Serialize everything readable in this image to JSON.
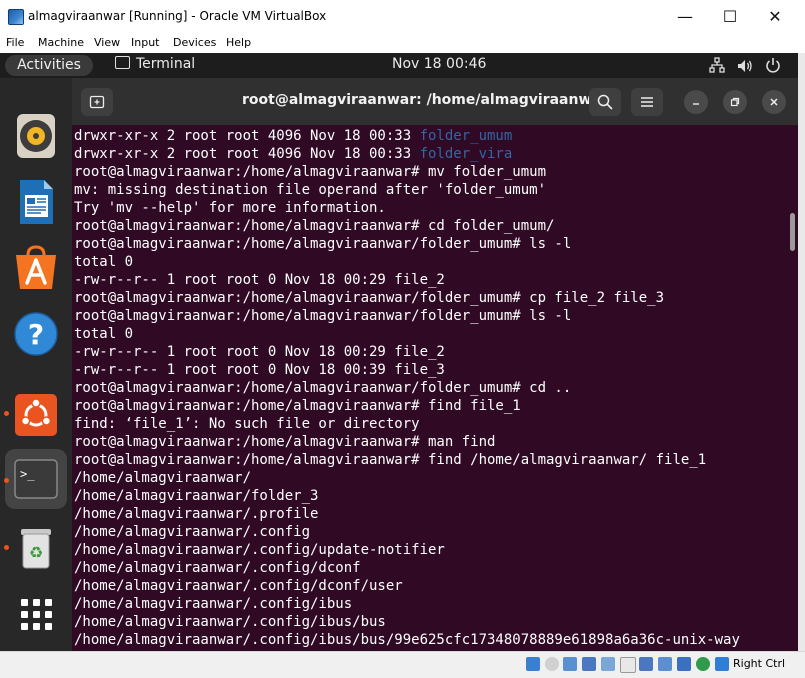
{
  "host": {
    "title": "almagviraanwar [Running] - Oracle VM VirtualBox",
    "controls": {
      "minimize": "—",
      "maximize": "☐",
      "close": "✕"
    },
    "menu": [
      "File",
      "Machine",
      "View",
      "Input",
      "Devices",
      "Help"
    ],
    "status_right": "Right Ctrl"
  },
  "gnome": {
    "activities": "Activities",
    "app": "Terminal",
    "clock": "Nov 18  00:46",
    "icons": [
      "network-icon",
      "volume-icon",
      "power-icon"
    ]
  },
  "dock": {
    "items": [
      "rhythmbox-icon",
      "writer-icon",
      "app-center-icon",
      "help-icon",
      "ubuntu-software-icon",
      "terminal-icon",
      "trash-icon",
      "show-apps-icon"
    ]
  },
  "terminal": {
    "title": "root@almagviraanwar: /home/almagviraanwar",
    "lines": [
      {
        "text": "drwxr-xr-x 2 root root 4096 Nov 18 00:33 ",
        "dir": "folder_umum"
      },
      {
        "text": "drwxr-xr-x 2 root root 4096 Nov 18 00:33 ",
        "dir": "folder_vira"
      },
      {
        "text": "root@almagviraanwar:/home/almagviraanwar# mv folder_umum"
      },
      {
        "text": "mv: missing destination file operand after 'folder_umum'"
      },
      {
        "text": "Try 'mv --help' for more information."
      },
      {
        "text": "root@almagviraanwar:/home/almagviraanwar# cd folder_umum/"
      },
      {
        "text": "root@almagviraanwar:/home/almagviraanwar/folder_umum# ls -l"
      },
      {
        "text": "total 0"
      },
      {
        "text": "-rw-r--r-- 1 root root 0 Nov 18 00:29 file_2"
      },
      {
        "text": "root@almagviraanwar:/home/almagviraanwar/folder_umum# cp file_2 file_3"
      },
      {
        "text": "root@almagviraanwar:/home/almagviraanwar/folder_umum# ls -l"
      },
      {
        "text": "total 0"
      },
      {
        "text": "-rw-r--r-- 1 root root 0 Nov 18 00:29 file_2"
      },
      {
        "text": "-rw-r--r-- 1 root root 0 Nov 18 00:39 file_3"
      },
      {
        "text": "root@almagviraanwar:/home/almagviraanwar/folder_umum# cd .."
      },
      {
        "text": "root@almagviraanwar:/home/almagviraanwar# find file_1"
      },
      {
        "text": "find: ‘file_1’: No such file or directory"
      },
      {
        "text": "root@almagviraanwar:/home/almagviraanwar# man find"
      },
      {
        "text": "root@almagviraanwar:/home/almagviraanwar# find /home/almagviraanwar/ file_1"
      },
      {
        "text": "/home/almagviraanwar/"
      },
      {
        "text": "/home/almagviraanwar/folder_3"
      },
      {
        "text": "/home/almagviraanwar/.profile"
      },
      {
        "text": "/home/almagviraanwar/.config"
      },
      {
        "text": "/home/almagviraanwar/.config/update-notifier"
      },
      {
        "text": "/home/almagviraanwar/.config/dconf"
      },
      {
        "text": "/home/almagviraanwar/.config/dconf/user"
      },
      {
        "text": "/home/almagviraanwar/.config/ibus"
      },
      {
        "text": "/home/almagviraanwar/.config/ibus/bus"
      },
      {
        "text": "/home/almagviraanwar/.config/ibus/bus/99e625cfc17348078889e61898a6a36c-unix-way"
      }
    ]
  },
  "colors": {
    "terminal_bg": "#300a24",
    "directory_blue": "#3465a4",
    "ubuntu_orange": "#e95420"
  }
}
